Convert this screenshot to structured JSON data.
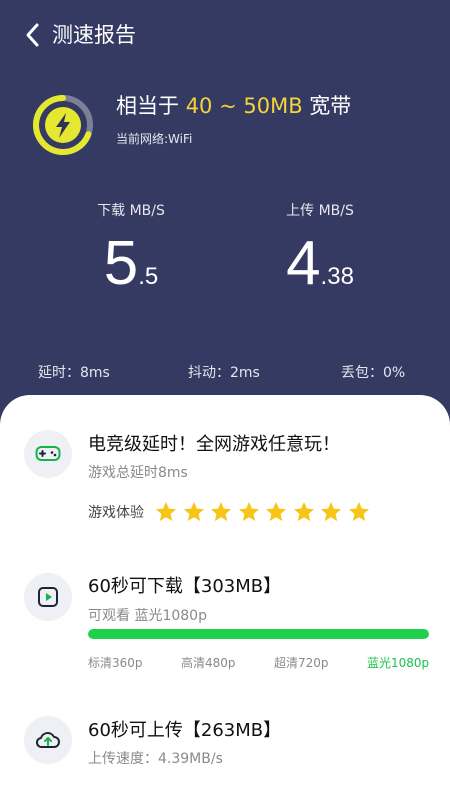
{
  "header": {
    "title": "测速报告"
  },
  "summary": {
    "prefix": "相当于 ",
    "range": "40 ~ 50MB",
    "suffix": " 宽带",
    "network": "当前网络:WiFi"
  },
  "speeds": {
    "download": {
      "label": "下载 MB/S",
      "int": "5",
      "dec": ".5"
    },
    "upload": {
      "label": "上传 MB/S",
      "int": "4",
      "dec": ".38"
    }
  },
  "metrics": {
    "latency": "延时：8ms",
    "jitter": "抖动：2ms",
    "loss": "丢包：0%"
  },
  "game": {
    "title": "电竞级延时！全网游戏任意玩！",
    "subtitle": "游戏总延时8ms",
    "rating_label": "游戏体验",
    "rating": 8,
    "rating_max": 8
  },
  "download_section": {
    "title": "60秒可下载【303MB】",
    "subtitle": "可观看 蓝光1080p",
    "progress": 1.0,
    "levels": [
      "标清360p",
      "高清480p",
      "超清720p",
      "蓝光1080p"
    ]
  },
  "upload_section": {
    "title": "60秒可上传【263MB】",
    "subtitle": "上传速度：4.39MB/s"
  },
  "colors": {
    "header_bg": "#353a63",
    "highlight": "#f5d33c",
    "accent_green": "#1fd04a",
    "star": "#f6c517"
  }
}
